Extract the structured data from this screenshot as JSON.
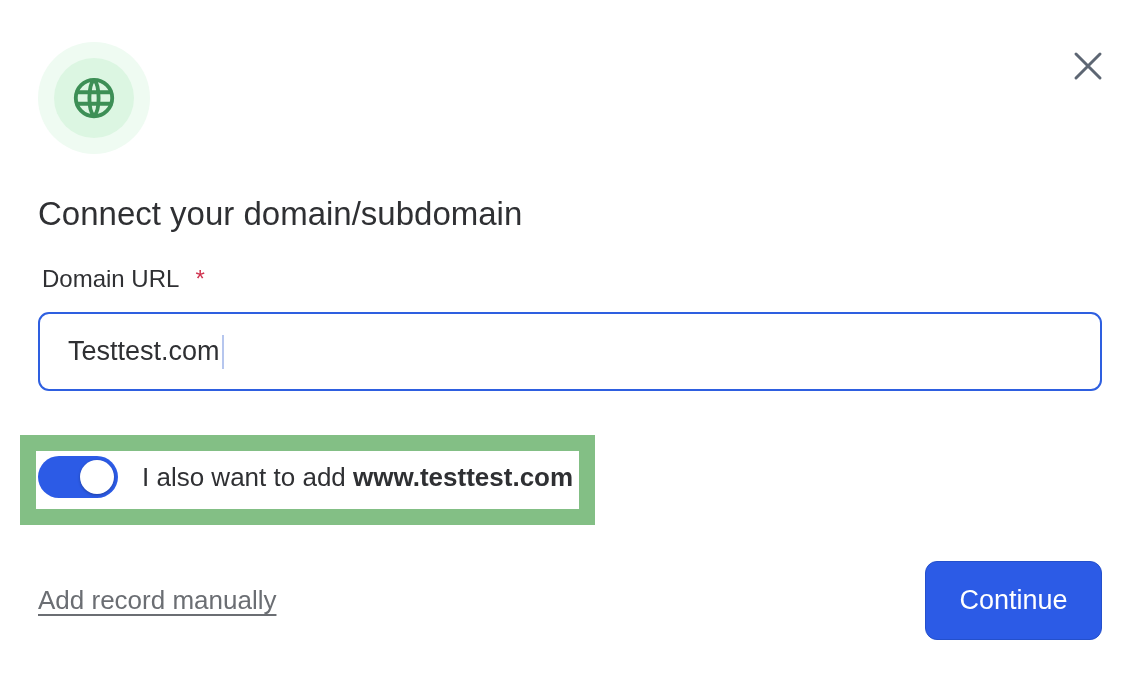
{
  "dialog": {
    "title": "Connect your domain/subdomain"
  },
  "domain_field": {
    "label": "Domain URL",
    "required_mark": "*",
    "value": "Testtest.com",
    "focused": true
  },
  "www_option": {
    "text": "I also want to add **www.testtest.com**",
    "on": true,
    "highlighted": true
  },
  "link": "Add record manually",
  "buttons": [
    "Continue"
  ]
}
